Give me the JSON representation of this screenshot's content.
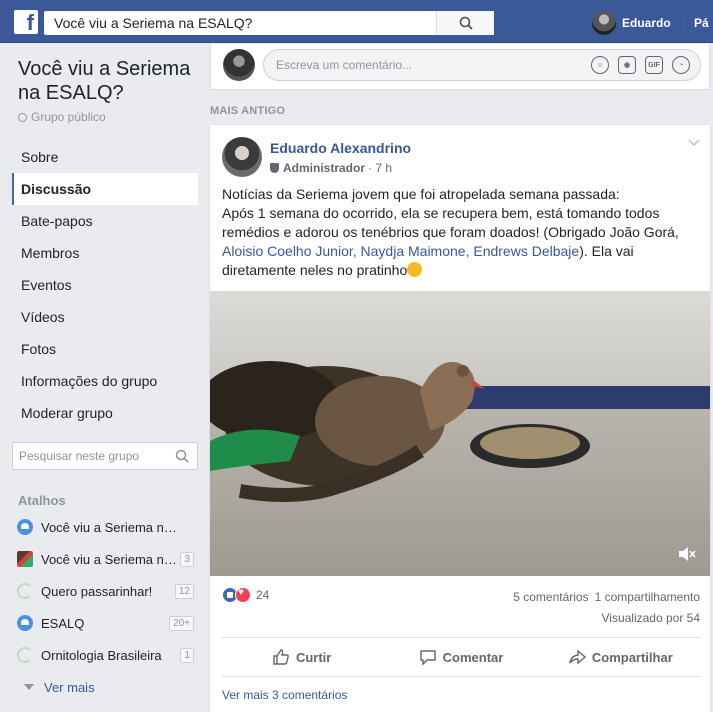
{
  "topbar": {
    "logo": "f",
    "search_value": "Você viu a Seriema na ESALQ?",
    "user_name": "Eduardo",
    "next_link": "Pá"
  },
  "group": {
    "title": "Você viu a Seriema na ESALQ?",
    "type": "Grupo público"
  },
  "nav": [
    {
      "label": "Sobre"
    },
    {
      "label": "Discussão",
      "active": true
    },
    {
      "label": "Bate-papos"
    },
    {
      "label": "Membros"
    },
    {
      "label": "Eventos"
    },
    {
      "label": "Vídeos"
    },
    {
      "label": "Fotos"
    },
    {
      "label": "Informações do grupo"
    },
    {
      "label": "Moderar grupo"
    }
  ],
  "side_search": {
    "placeholder": "Pesquisar neste grupo"
  },
  "shortcuts": {
    "title": "Atalhos",
    "items": [
      {
        "label": "Você viu a Seriema na ESALQ?",
        "icon": "group-icon",
        "badge": ""
      },
      {
        "label": "Você viu a Seriema na ESALQ?",
        "icon": "photo-icon",
        "badge": "3"
      },
      {
        "label": "Quero passarinhar!",
        "icon": "bird-icon",
        "badge": "12"
      },
      {
        "label": "ESALQ",
        "icon": "group-icon",
        "badge": "20+"
      },
      {
        "label": "Ornitologia Brasileira",
        "icon": "bird-icon",
        "badge": "1"
      }
    ],
    "more": "Ver mais"
  },
  "comment_box": {
    "placeholder": "Escreva um comentário..."
  },
  "section_label": "MAIS ANTIGO",
  "post": {
    "author": "Eduardo Alexandrino",
    "role": "Administrador",
    "time": "· 7 h",
    "text_1": "Notícias da Seriema jovem que foi atropelada semana passada:",
    "text_2": "Após 1 semana do ocorrido, ela se recupera bem, está tomando todos remédios e adorou os tenébrios que foram doados! (Obrigado João Gorá, ",
    "tags": "Aloisio Coelho Junior, Naydja Maimone, Endrews Delbaje",
    "text_3": "). Ela vai diretamente neles no pratinho",
    "reaction_count": "24",
    "comments": "5 comentários",
    "shares": "1 compartilhamento",
    "views": "Visualizado por 54",
    "like": "Curtir",
    "comment": "Comentar",
    "share": "Compartilhar",
    "more_comments": "Ver mais 3 comentários"
  },
  "colors": {
    "brand": "#3b5998",
    "link": "#365899",
    "like": "#4267b2",
    "love": "#f33e58"
  }
}
